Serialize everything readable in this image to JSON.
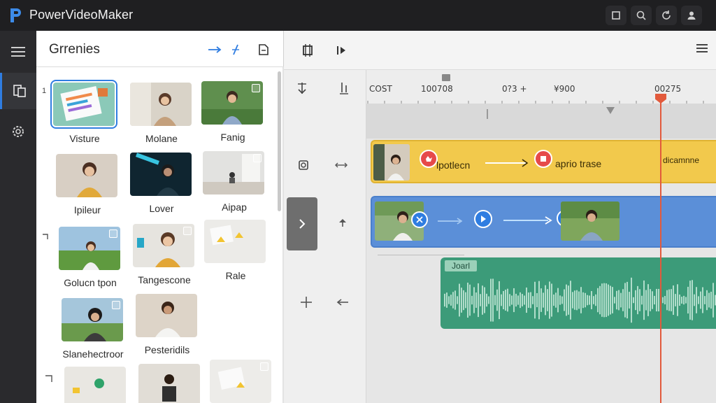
{
  "app": {
    "title": "PowerVideoMaker"
  },
  "titlebar_icons": [
    "crop-icon",
    "zoom-icon",
    "refresh-icon",
    "user-icon"
  ],
  "rail": {
    "items": [
      "menu-icon",
      "library-icon",
      "settings-icon"
    ]
  },
  "media_panel": {
    "title": "Grrenies",
    "markers": [
      "1"
    ],
    "items": [
      {
        "label": "Visture",
        "selected": true
      },
      {
        "label": "Molane"
      },
      {
        "label": "Fanig"
      },
      {
        "label": "Ipileur"
      },
      {
        "label": "Lover"
      },
      {
        "label": "Aipap"
      },
      {
        "label": "Golucn tpon"
      },
      {
        "label": "Tangescone"
      },
      {
        "label": "Rale"
      },
      {
        "label": "Slanehectroor"
      },
      {
        "label": "Pesteridils"
      },
      {
        "label": ""
      },
      {
        "label": ""
      },
      {
        "label": ""
      },
      {
        "label": ""
      }
    ]
  },
  "timeline": {
    "ruler_labels": [
      "COST",
      "100708",
      "0?3 +",
      "¥900",
      "00275"
    ],
    "tracks": {
      "yellow": {
        "label_1": "lpotlecn",
        "label_2": "aprio trase",
        "label_3": "dicamnne"
      },
      "blue": {},
      "audio": {
        "label": "Joarl"
      }
    }
  },
  "colors": {
    "accent": "#2f7de1",
    "titlebar": "#1f1f21",
    "yellow_track": "#f2c94c",
    "blue_track": "#5b8fd8",
    "audio_track": "#3c9b79",
    "playhead": "#e25a3c"
  }
}
